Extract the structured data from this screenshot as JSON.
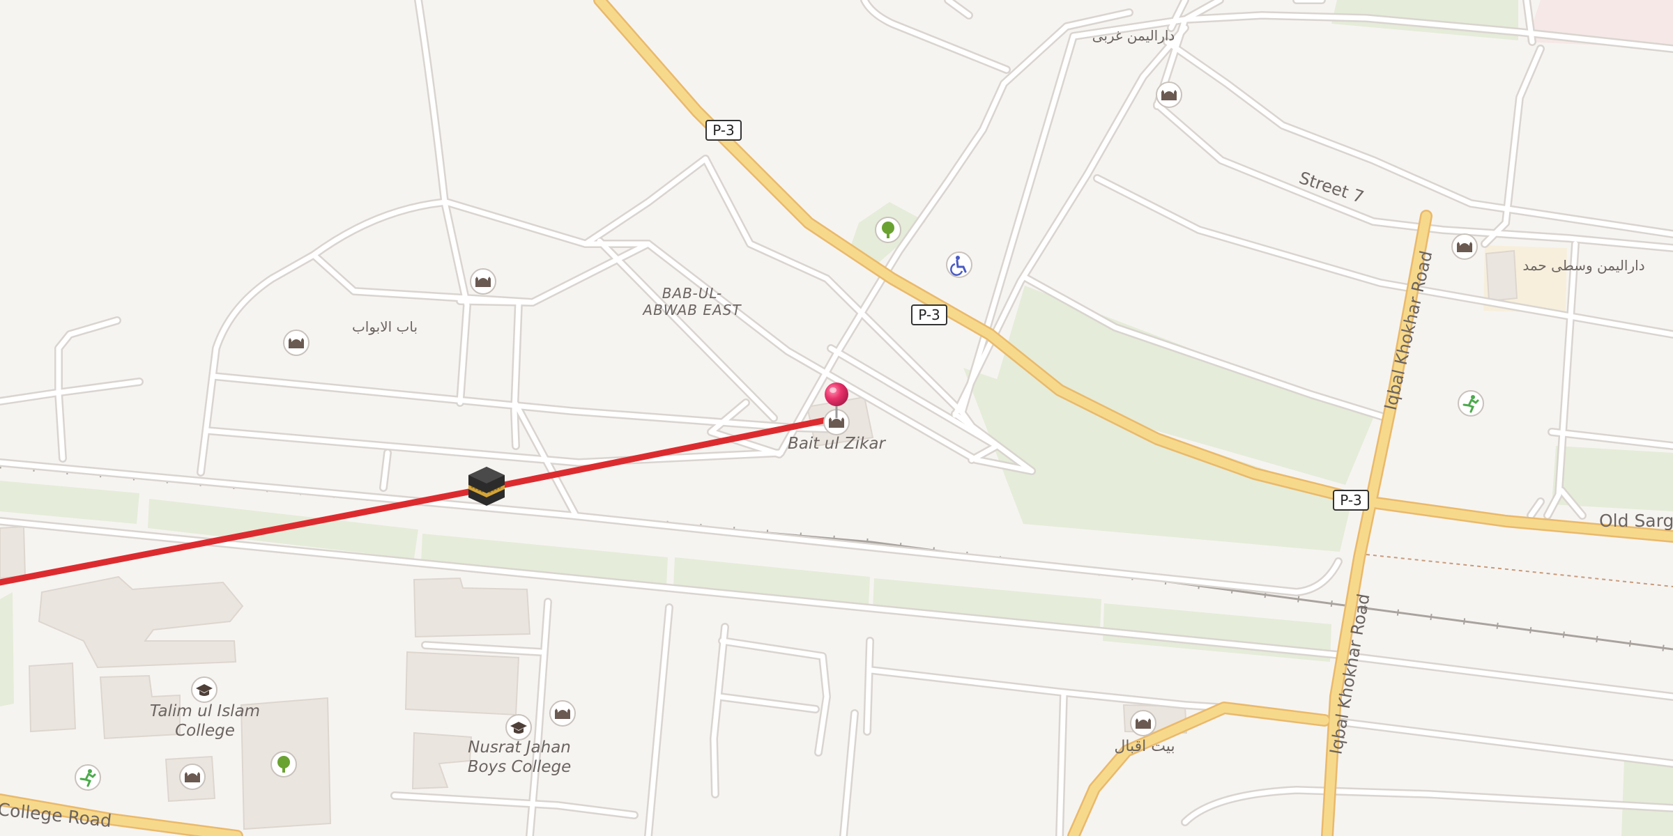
{
  "road_shields": {
    "p3_a": "P-3",
    "p3_b": "P-3",
    "p3_c": "P-3"
  },
  "street_labels": {
    "street7": "Street 7",
    "iqbal_khokhar_north": "Iqbal Khokhar Road",
    "iqbal_khokhar_south": "Iqbal Khokhar Road",
    "old_sargodha": "Old Sargo",
    "college_road": "College Road"
  },
  "area_labels": {
    "bab_ul_abwab_east_line1": "BAB-UL-",
    "bab_ul_abwab_east_line2": "ABWAB EAST",
    "bab_ul_abwab_urdu": "باب الابواب",
    "dar_ul_yaman_gharbi": "دارالیمن غربی",
    "dar_ul_yaman_wasti_hamd": "دارالیمن وسطی حمد",
    "bait_iqbal": "بیت اقبال"
  },
  "poi_labels": {
    "bait_ul_zikar": "Bait ul Zikar",
    "talim_ul_islam_line1": "Talim ul Islam",
    "talim_ul_islam_line2": "College",
    "nusrat_jahan_line1": "Nusrat Jahan",
    "nusrat_jahan_line2": "Boys College"
  },
  "icons": {
    "mosque": "mosque-icon",
    "park": "tree-icon",
    "school": "graduation-cap-icon",
    "sports": "running-icon",
    "wheelchair": "wheelchair-icon",
    "kaaba": "kaaba-icon",
    "pin": "map-pin-icon"
  },
  "colors": {
    "background": "#f6f4f1",
    "primary_road": "#f7d98c",
    "primary_road_casing": "#e9b96b",
    "minor_road": "#ffffff",
    "minor_road_casing": "#d9d4cf",
    "park": "#e5ecd9",
    "building": "#ebe5df",
    "route_line": "#dc2b2f",
    "pin": "#e8316a",
    "railway": "#a9a39e",
    "label": "#6b6461"
  }
}
